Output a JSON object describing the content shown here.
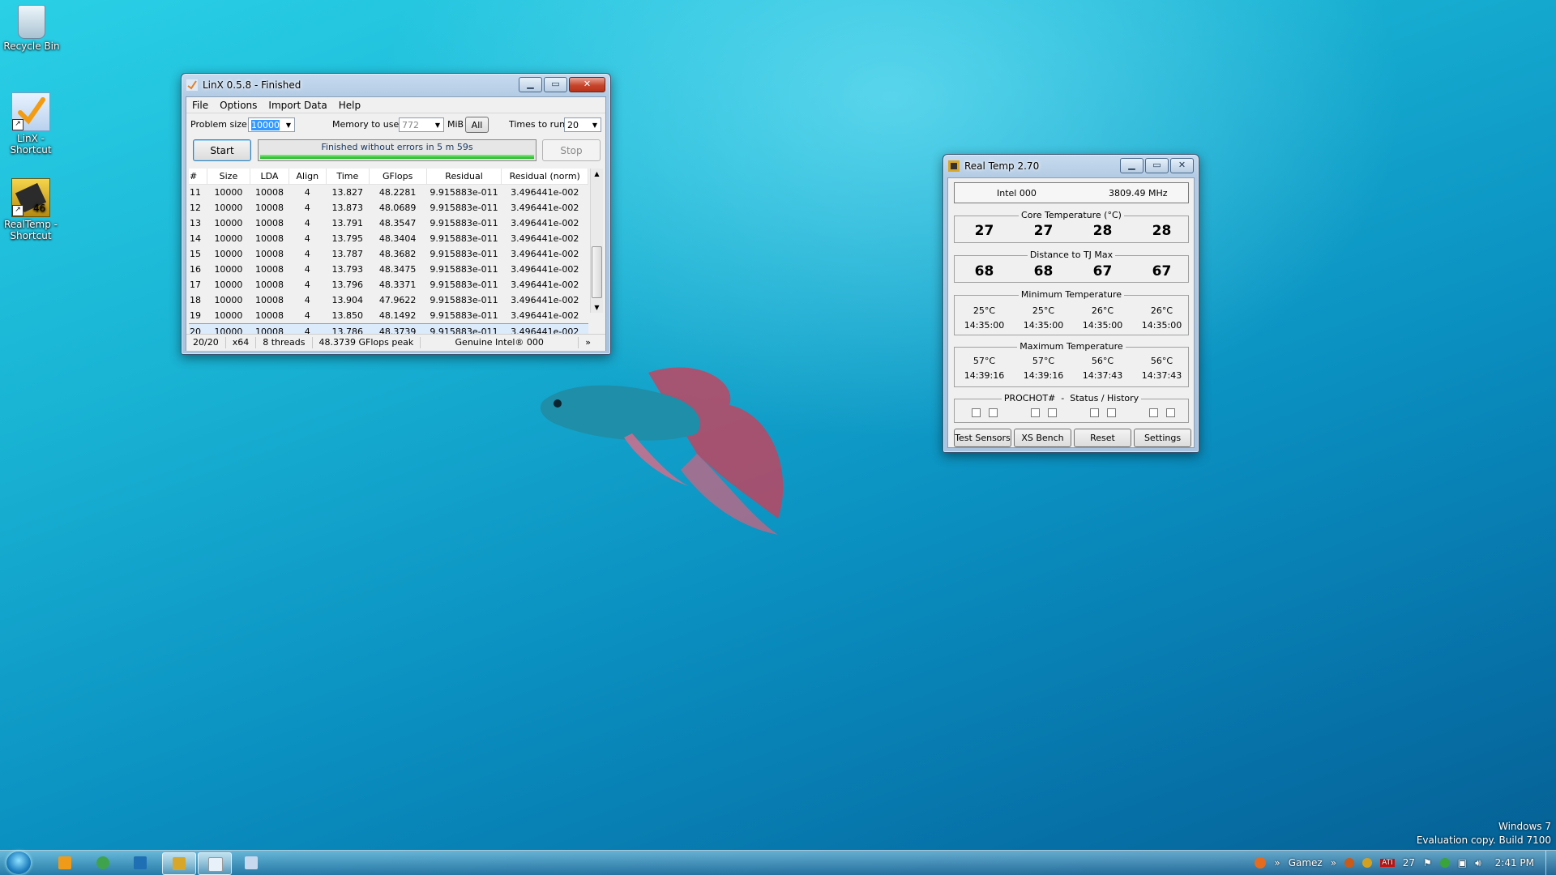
{
  "desktop": {
    "icons": [
      {
        "label": "Recycle Bin"
      },
      {
        "label": "LinX - Shortcut"
      },
      {
        "label": "RealTemp - Shortcut"
      }
    ],
    "watermark": {
      "line1": "Windows 7",
      "line2": "Evaluation copy. Build 7100"
    }
  },
  "linx": {
    "title": "LinX 0.5.8 - Finished",
    "menu": [
      "File",
      "Options",
      "Import Data",
      "Help"
    ],
    "problem_size_label": "Problem size:",
    "problem_size_value": "10000",
    "memory_label": "Memory to use:",
    "memory_value": "772",
    "memory_unit": "MiB",
    "all_button": "All",
    "times_label": "Times to run:",
    "times_value": "20",
    "start_button": "Start",
    "progress_text": "Finished without errors in 5 m 59s",
    "progress_fraction": 1.0,
    "stop_button": "Stop",
    "columns": [
      "#",
      "Size",
      "LDA",
      "Align",
      "Time",
      "GFlops",
      "Residual",
      "Residual (norm)"
    ],
    "rows": [
      [
        "11",
        "10000",
        "10008",
        "4",
        "13.827",
        "48.2281",
        "9.915883e-011",
        "3.496441e-002"
      ],
      [
        "12",
        "10000",
        "10008",
        "4",
        "13.873",
        "48.0689",
        "9.915883e-011",
        "3.496441e-002"
      ],
      [
        "13",
        "10000",
        "10008",
        "4",
        "13.791",
        "48.3547",
        "9.915883e-011",
        "3.496441e-002"
      ],
      [
        "14",
        "10000",
        "10008",
        "4",
        "13.795",
        "48.3404",
        "9.915883e-011",
        "3.496441e-002"
      ],
      [
        "15",
        "10000",
        "10008",
        "4",
        "13.787",
        "48.3682",
        "9.915883e-011",
        "3.496441e-002"
      ],
      [
        "16",
        "10000",
        "10008",
        "4",
        "13.793",
        "48.3475",
        "9.915883e-011",
        "3.496441e-002"
      ],
      [
        "17",
        "10000",
        "10008",
        "4",
        "13.796",
        "48.3371",
        "9.915883e-011",
        "3.496441e-002"
      ],
      [
        "18",
        "10000",
        "10008",
        "4",
        "13.904",
        "47.9622",
        "9.915883e-011",
        "3.496441e-002"
      ],
      [
        "19",
        "10000",
        "10008",
        "4",
        "13.850",
        "48.1492",
        "9.915883e-011",
        "3.496441e-002"
      ],
      [
        "20",
        "10000",
        "10008",
        "4",
        "13.786",
        "48.3739",
        "9.915883e-011",
        "3.496441e-002"
      ]
    ],
    "selected_row": "20",
    "status": [
      "20/20",
      "x64",
      "8 threads",
      "48.3739 GFlops peak",
      "Genuine Intel® 000"
    ],
    "status_more": "»"
  },
  "realtemp": {
    "title": "Real Temp 2.70",
    "cpu_name": "Intel 000",
    "cpu_freq": "3809.49 MHz",
    "core_temp_label": "Core Temperature (°C)",
    "core_temps": [
      "27",
      "27",
      "28",
      "28"
    ],
    "tjmax_label": "Distance to TJ Max",
    "tjmax": [
      "68",
      "68",
      "67",
      "67"
    ],
    "min_label": "Minimum Temperature",
    "min_temps": [
      "25°C",
      "25°C",
      "26°C",
      "26°C"
    ],
    "min_times": [
      "14:35:00",
      "14:35:00",
      "14:35:00",
      "14:35:00"
    ],
    "max_label": "Maximum Temperature",
    "max_temps": [
      "57°C",
      "57°C",
      "56°C",
      "56°C"
    ],
    "max_times": [
      "14:39:16",
      "14:39:16",
      "14:37:43",
      "14:37:43"
    ],
    "prochot_label": "PROCHOT#  -  Status / History",
    "buttons": [
      "Test Sensors",
      "XS Bench",
      "Reset",
      "Settings"
    ]
  },
  "taskbar": {
    "toolbar_label": "Gamez",
    "tray_temp": "27",
    "clock": "2:41 PM",
    "ati_label": "ATI"
  }
}
